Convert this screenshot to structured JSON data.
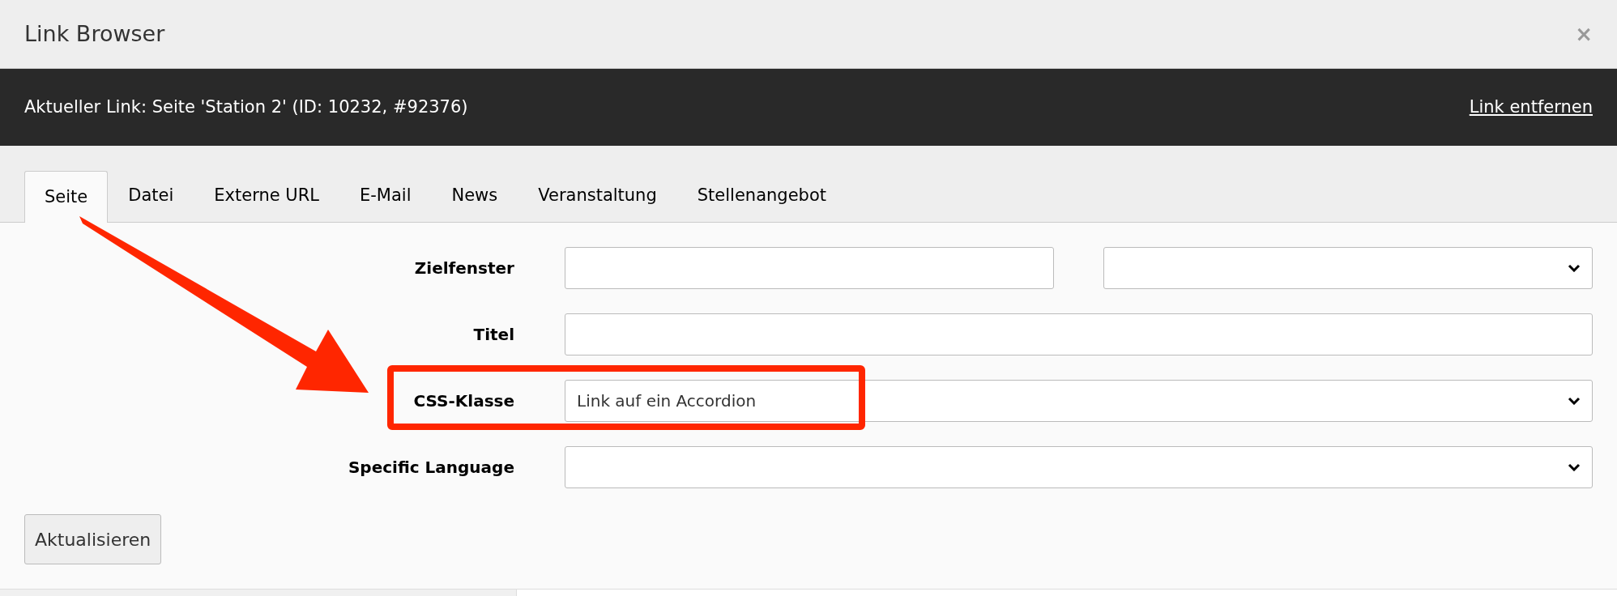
{
  "window": {
    "title": "Link Browser",
    "close": "×"
  },
  "current_link": {
    "text": "Aktueller Link: Seite 'Station 2' (ID: 10232, #92376)",
    "remove_link": "Link entfernen"
  },
  "tabs": [
    {
      "label": "Seite",
      "selected": true
    },
    {
      "label": "Datei",
      "selected": false
    },
    {
      "label": "Externe URL",
      "selected": false
    },
    {
      "label": "E-Mail",
      "selected": false
    },
    {
      "label": "News",
      "selected": false
    },
    {
      "label": "Veranstaltung",
      "selected": false
    },
    {
      "label": "Stellenangebot",
      "selected": false
    }
  ],
  "form": {
    "rows": [
      {
        "label": "Zielfenster",
        "highlighted": false,
        "controls": [
          {
            "kind": "text"
          },
          {
            "kind": "select"
          }
        ]
      },
      {
        "label": "Titel",
        "highlighted": false,
        "controls": [
          {
            "kind": "text"
          }
        ]
      },
      {
        "label": "CSS-Klasse",
        "highlighted": true,
        "controls": [
          {
            "kind": "select",
            "value": "Link auf ein Accordion"
          }
        ]
      },
      {
        "label": "Specific Language",
        "highlighted": false,
        "controls": [
          {
            "kind": "select"
          }
        ]
      }
    ],
    "submit": "Aktualisieren"
  }
}
